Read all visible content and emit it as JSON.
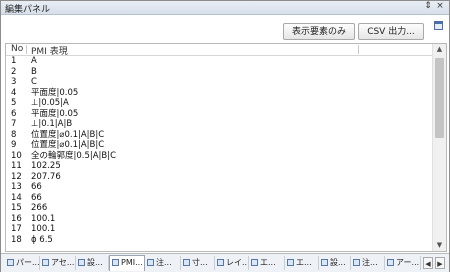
{
  "window": {
    "title": "編集パネル",
    "pin_glyph": "⇕",
    "close_glyph": "×"
  },
  "toolbar": {
    "show_element_label": "表示要素のみ",
    "csv_export_label": "CSV 出力..."
  },
  "table": {
    "col_no": "No",
    "col_pmi": "PMI 表現",
    "rows": [
      {
        "no": "1",
        "pmi": "A"
      },
      {
        "no": "2",
        "pmi": "B"
      },
      {
        "no": "3",
        "pmi": "C"
      },
      {
        "no": "4",
        "pmi": "平面度|0.05"
      },
      {
        "no": "5",
        "pmi": "⊥|0.05|A"
      },
      {
        "no": "6",
        "pmi": "平面度|0.05"
      },
      {
        "no": "7",
        "pmi": "⊥|0.1|A|B"
      },
      {
        "no": "8",
        "pmi": "位置度|⌀0.1|A|B|C"
      },
      {
        "no": "9",
        "pmi": "位置度|⌀0.1|A|B|C"
      },
      {
        "no": "10",
        "pmi": "全の輪郭度|0.5|A|B|C"
      },
      {
        "no": "11",
        "pmi": "102.25"
      },
      {
        "no": "12",
        "pmi": "207.76"
      },
      {
        "no": "13",
        "pmi": "66"
      },
      {
        "no": "14",
        "pmi": "66"
      },
      {
        "no": "15",
        "pmi": "266"
      },
      {
        "no": "16",
        "pmi": "100.1"
      },
      {
        "no": "17",
        "pmi": "100.1"
      },
      {
        "no": "18",
        "pmi": "ϕ 6.5"
      }
    ]
  },
  "tabs": [
    {
      "label": "パー..."
    },
    {
      "label": "アセ..."
    },
    {
      "label": "設..."
    },
    {
      "label": "PMI..."
    },
    {
      "label": "注..."
    },
    {
      "label": "寸..."
    },
    {
      "label": "レイ..."
    },
    {
      "label": "エ..."
    },
    {
      "label": "エ..."
    },
    {
      "label": "設..."
    },
    {
      "label": "注..."
    },
    {
      "label": "アー..."
    }
  ],
  "tab_nav": {
    "prev": "◀",
    "next": "▶"
  },
  "icons": {
    "panel_corner": "layout-icon",
    "tab_icon": "document-icon"
  }
}
